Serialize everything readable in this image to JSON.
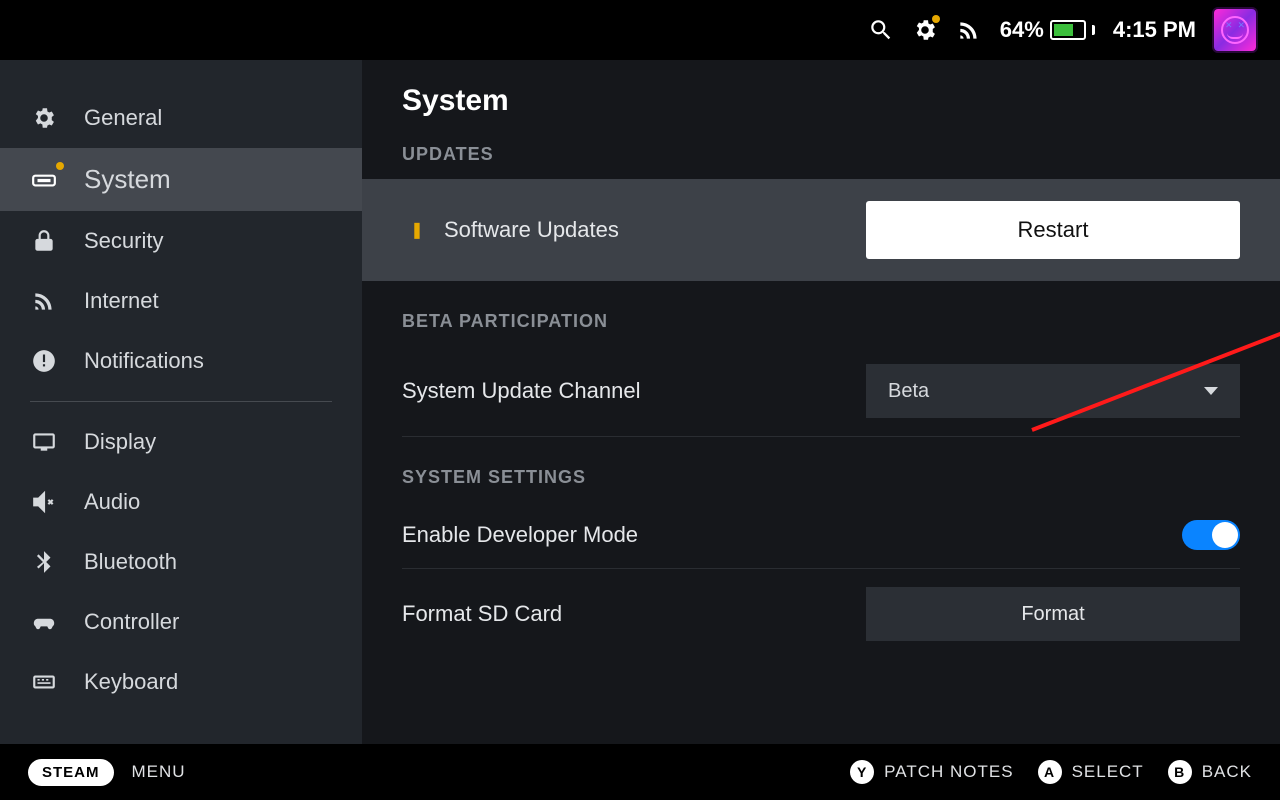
{
  "topbar": {
    "battery_pct": "64%",
    "clock": "4:15 PM"
  },
  "sidebar": {
    "items": [
      {
        "icon": "gear",
        "label": "General"
      },
      {
        "icon": "deck",
        "label": "System"
      },
      {
        "icon": "lock",
        "label": "Security"
      },
      {
        "icon": "wifi",
        "label": "Internet"
      },
      {
        "icon": "bell",
        "label": "Notifications"
      },
      {
        "icon": "display",
        "label": "Display"
      },
      {
        "icon": "mute",
        "label": "Audio"
      },
      {
        "icon": "bt",
        "label": "Bluetooth"
      },
      {
        "icon": "pad",
        "label": "Controller"
      },
      {
        "icon": "kb",
        "label": "Keyboard"
      }
    ]
  },
  "main": {
    "title": "System",
    "updates_label": "UPDATES",
    "software_updates": "Software Updates",
    "restart": "Restart",
    "beta_label": "BETA PARTICIPATION",
    "channel_label": "System Update Channel",
    "channel_value": "Beta",
    "settings_label": "SYSTEM SETTINGS",
    "dev_mode": "Enable Developer Mode",
    "format_sd": "Format SD Card",
    "format_btn": "Format"
  },
  "bottom": {
    "steam": "STEAM",
    "menu": "MENU",
    "y": "PATCH NOTES",
    "a": "SELECT",
    "b": "BACK"
  }
}
